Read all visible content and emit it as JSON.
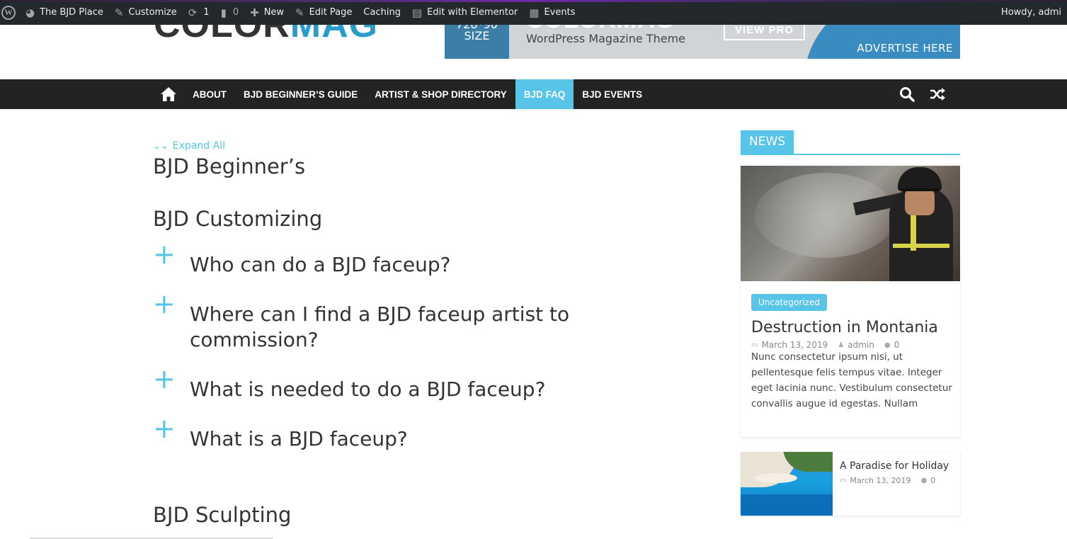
{
  "admin_bar": {
    "site_name": "The BJD Place",
    "customize": "Customize",
    "updates_count": "1",
    "comments_count": "0",
    "new": "New",
    "edit_page": "Edit Page",
    "caching": "Caching",
    "elementor": "Edit with Elementor",
    "events": "Events",
    "howdy": "Howdy, admi"
  },
  "header": {
    "logo_part1": "COLOR",
    "logo_part2": "MAG",
    "banner": {
      "size_dims": "728*90",
      "size_label": "SIZE",
      "title": "COLORMAG",
      "subtitle": "WordPress Magazine Theme",
      "cta": "VIEW PRO",
      "advertise": "ADVERTISE HERE"
    }
  },
  "nav": {
    "items": [
      {
        "label": "ABOUT"
      },
      {
        "label": "BJD BEGINNER’S GUIDE"
      },
      {
        "label": "ARTIST & SHOP DIRECTORY"
      },
      {
        "label": "BJD FAQ"
      },
      {
        "label": "BJD EVENTS"
      }
    ]
  },
  "faq": {
    "expand_all": "Expand All",
    "categories": [
      {
        "title": "BJD Beginner’s"
      },
      {
        "title": "BJD Customizing"
      },
      {
        "title": "BJD Sculpting"
      }
    ],
    "questions": [
      {
        "q": "Who can do a BJD faceup?"
      },
      {
        "q": "Where can I find a BJD faceup artist to commission?"
      },
      {
        "q": "What is needed to do a BJD faceup?"
      },
      {
        "q": "What is a BJD faceup?"
      }
    ]
  },
  "sidebar": {
    "widget_title": "NEWS",
    "featured": {
      "category": "Uncategorized",
      "title": "Destruction in Montania",
      "date": "March 13, 2019",
      "author": "admin",
      "comments": "0",
      "excerpt": "Nunc consectetur ipsum nisi, ut pellentesque felis tempus vitae. Integer eget lacinia nunc. Vestibulum consectetur convallis augue id egestas. Nullam"
    },
    "second": {
      "title": "A Paradise for Holiday",
      "date": "March 13, 2019",
      "comments": "0"
    }
  },
  "colors": {
    "accent": "#58c4e8",
    "nav_bg": "#232323",
    "admin_bar_bg": "#23282d"
  }
}
